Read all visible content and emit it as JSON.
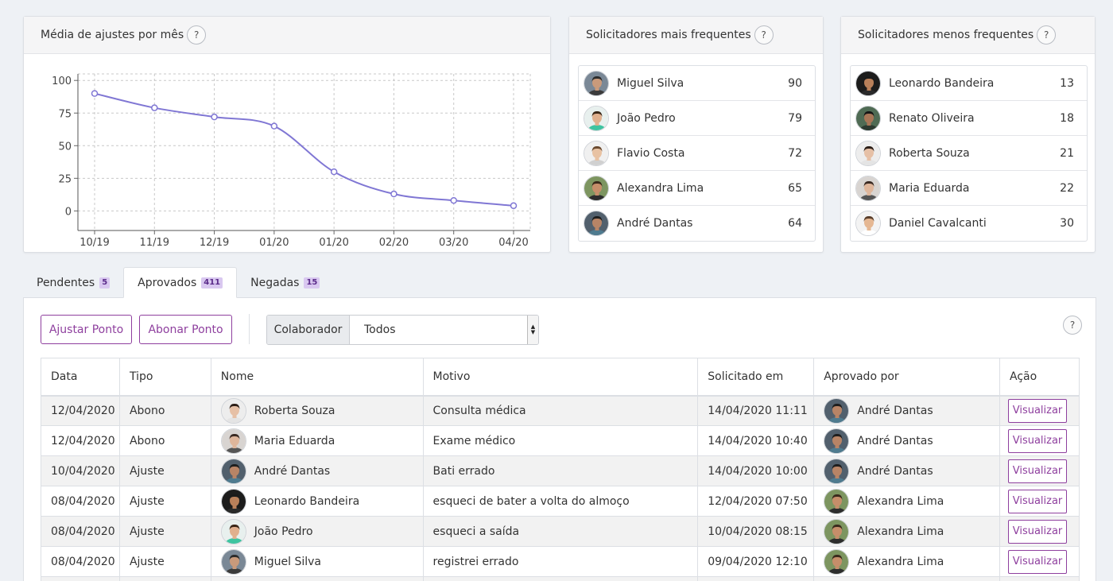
{
  "chart_card": {
    "title": "Média de ajustes por mês",
    "help": "?"
  },
  "chart_data": {
    "type": "line",
    "title": "",
    "categories": [
      "10/19",
      "11/19",
      "12/19",
      "01/20",
      "01/20",
      "02/20",
      "03/20",
      "04/20"
    ],
    "series": [
      {
        "values": [
          90,
          79,
          72,
          65,
          30,
          13,
          8,
          4
        ]
      }
    ],
    "yticks": [
      100,
      75,
      50,
      25,
      0
    ],
    "ylim": [
      -15,
      105
    ],
    "grid": true,
    "line_color": "#8077d4"
  },
  "top_requesters": {
    "title": "Solicitadores mais frequentes",
    "help": "?",
    "items": [
      {
        "name": "Miguel Silva",
        "value": "90",
        "avatar": "man-dark-hair-avatar"
      },
      {
        "name": "João Pedro",
        "value": "79",
        "avatar": "man-green-shirt-avatar"
      },
      {
        "name": "Flavio Costa",
        "value": "72",
        "avatar": "man-light-avatar"
      },
      {
        "name": "Alexandra Lima",
        "value": "65",
        "avatar": "woman-curly-avatar"
      },
      {
        "name": "André Dantas",
        "value": "64",
        "avatar": "man-plaid-avatar"
      }
    ]
  },
  "bottom_requesters": {
    "title": "Solicitadores menos frequentes",
    "help": "?",
    "items": [
      {
        "name": "Leonardo Bandeira",
        "value": "13",
        "avatar": "man-beard-avatar"
      },
      {
        "name": "Renato Oliveira",
        "value": "18",
        "avatar": "man-outdoor-avatar"
      },
      {
        "name": "Roberta Souza",
        "value": "21",
        "avatar": "woman-dark-hair-avatar"
      },
      {
        "name": "Maria Eduarda",
        "value": "22",
        "avatar": "woman-brown-hair-avatar"
      },
      {
        "name": "Daniel Cavalcanti",
        "value": "30",
        "avatar": "man-smiling-avatar"
      }
    ]
  },
  "tabs": [
    {
      "label": "Pendentes",
      "count": "5"
    },
    {
      "label": "Aprovados",
      "count": "411"
    },
    {
      "label": "Negadas",
      "count": "15"
    }
  ],
  "toolbar": {
    "adjust_label": "Ajustar Ponto",
    "excuse_label": "Abonar Ponto",
    "filter_prefix": "Colaborador",
    "filter_value": "Todos",
    "help": "?"
  },
  "colors": {
    "accent": "#8e3f9e",
    "badge_bg": "#d9c8f0"
  },
  "table": {
    "headers": [
      "Data",
      "Tipo",
      "Nome",
      "Motivo",
      "Solicitado em",
      "Aprovado por",
      "Ação"
    ],
    "action_label": "Visualizar",
    "rows": [
      {
        "date": "12/04/2020",
        "type": "Abono",
        "name": "Roberta Souza",
        "reason": "Consulta médica",
        "requested": "14/04/2020 11:11",
        "approver": "André Dantas"
      },
      {
        "date": "12/04/2020",
        "type": "Abono",
        "name": "Maria Eduarda",
        "reason": "Exame médico",
        "requested": "14/04/2020 10:40",
        "approver": "André Dantas"
      },
      {
        "date": "10/04/2020",
        "type": "Ajuste",
        "name": "André Dantas",
        "reason": "Bati errado",
        "requested": "14/04/2020 10:00",
        "approver": "André Dantas"
      },
      {
        "date": "08/04/2020",
        "type": "Ajuste",
        "name": "Leonardo Bandeira",
        "reason": "esqueci de bater a volta do almoço",
        "requested": "12/04/2020 07:50",
        "approver": "Alexandra Lima"
      },
      {
        "date": "08/04/2020",
        "type": "Ajuste",
        "name": "João Pedro",
        "reason": "esqueci a saída",
        "requested": "10/04/2020 08:15",
        "approver": "Alexandra Lima"
      },
      {
        "date": "08/04/2020",
        "type": "Ajuste",
        "name": "Miguel Silva",
        "reason": "registrei errado",
        "requested": "09/04/2020 12:10",
        "approver": "Alexandra Lima"
      },
      {
        "date": "",
        "type": "",
        "name": "",
        "reason": "",
        "requested": "",
        "approver": ""
      }
    ]
  }
}
